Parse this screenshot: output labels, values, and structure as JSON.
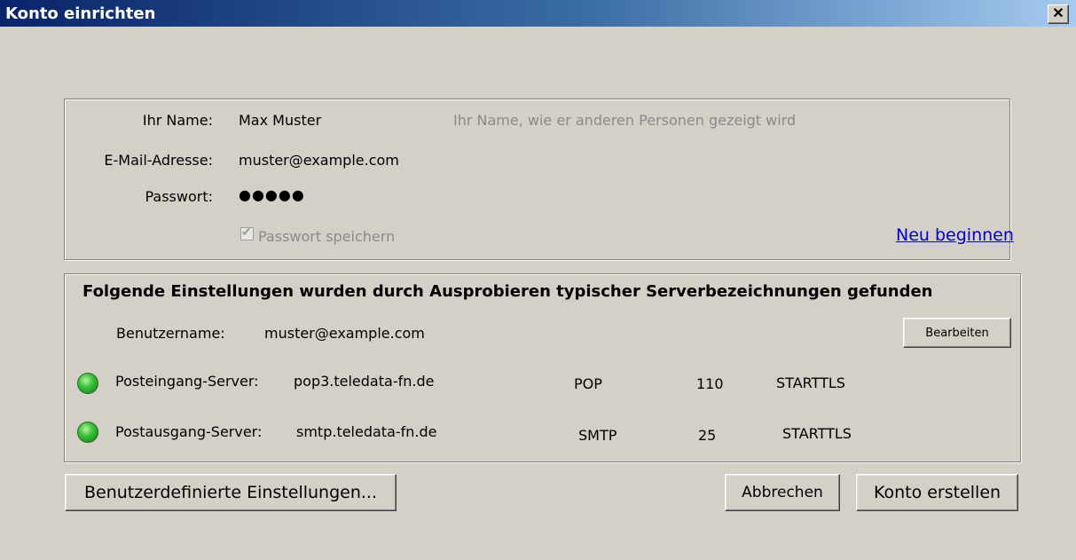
{
  "window": {
    "title": "Konto einrichten",
    "close_glyph": "✕"
  },
  "account": {
    "name_label": "Ihr Name:",
    "name_value": "Max Muster",
    "name_hint": "Ihr Name, wie er anderen Personen gezeigt wird",
    "email_label": "E-Mail-Adresse:",
    "email_value": "muster@example.com",
    "password_label": "Passwort:",
    "password_value": "●●●●●",
    "save_password_label": "Passwort speichern",
    "save_password_checked": true,
    "restart_link": "Neu beginnen"
  },
  "settings": {
    "heading": "Folgende Einstellungen wurden durch Ausprobieren typischer Serverbezeichnungen gefunden",
    "username_label": "Benutzername:",
    "username_value": "muster@example.com",
    "edit_button": "Bearbeiten",
    "servers": [
      {
        "label": "Posteingang-Server:",
        "host": "pop3.teledata-fn.de",
        "protocol": "POP",
        "port": "110",
        "security": "STARTTLS",
        "status_color": "#2fb52c"
      },
      {
        "label": "Postausgang-Server:",
        "host": "smtp.teledata-fn.de",
        "protocol": "SMTP",
        "port": "25",
        "security": "STARTTLS",
        "status_color": "#2fb52c"
      }
    ]
  },
  "buttons": {
    "custom_settings": "Benutzerdefinierte Einstellungen...",
    "cancel": "Abbrechen",
    "create_account": "Konto erstellen"
  }
}
